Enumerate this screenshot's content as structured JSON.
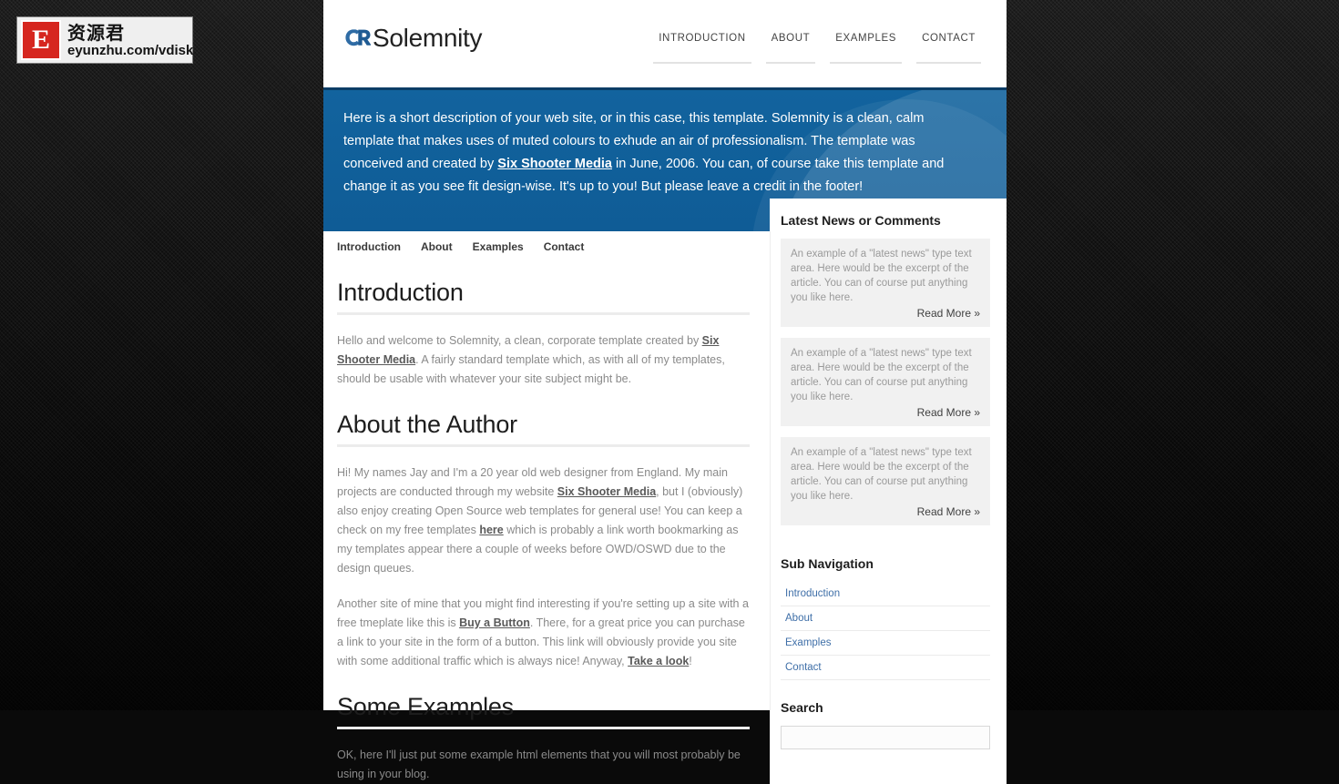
{
  "watermark": {
    "logo_letter": "E",
    "chinese_text": "资源君",
    "url_text": "eyunzhu.com/vdisk"
  },
  "header": {
    "logo_text": "Solemnity",
    "logo_icon": "interlocking-circles-logo-icon",
    "nav": [
      {
        "label": "INTRODUCTION"
      },
      {
        "label": "ABOUT"
      },
      {
        "label": "EXAMPLES"
      },
      {
        "label": "CONTACT"
      }
    ]
  },
  "banner": {
    "text_part1": "Here is a short description of your web site, or in this case, this template. Solemnity is a clean, calm template that makes uses of muted colours to exhude an air of professionalism. The template was conceived and created by ",
    "link_label": "Six Shooter Media",
    "text_part2": " in June, 2006. You can, of course take this template and change it as you see fit design-wise. It's up to you! But please leave a credit in the footer!"
  },
  "content": {
    "subnav": [
      {
        "label": "Introduction"
      },
      {
        "label": "About"
      },
      {
        "label": "Examples"
      },
      {
        "label": "Contact"
      }
    ],
    "sections": [
      {
        "title": "Introduction",
        "p1_a": "Hello and welcome to Solemnity, a clean, corporate template created by ",
        "p1_link": "Six Shooter Media",
        "p1_b": ". A fairly standard template which, as with all of my templates, should be usable with whatever your site subject might be."
      },
      {
        "title": "About the Author",
        "p1_a": "Hi! My names Jay and I'm a 20 year old web designer from England. My main projects are conducted through my website ",
        "p1_link": "Six Shooter Media",
        "p1_b": ", but I (obviously) also enjoy creating Open Source web templates for general use! You can keep a check on my free templates ",
        "p1_link2": "here",
        "p1_c": " which is probably a link worth bookmarking as my templates appear there a couple of weeks before OWD/OSWD due to the design queues.",
        "p2_a": "Another site of mine that you might find interesting if you're setting up a site with a free tmeplate like this is ",
        "p2_link": "Buy a Button",
        "p2_b": ". There, for a great price you can purchase a link to your site in the form of a button. This link will obviously provide you site with some additional traffic which is always nice! Anyway, ",
        "p2_link2": "Take a look",
        "p2_c": "!"
      },
      {
        "title": "Some Examples",
        "p1": "OK, here I'll just put some example html elements that you will most probably be using in your blog."
      }
    ]
  },
  "sidebar": {
    "news_title": "Latest News or Comments",
    "news_items": [
      {
        "text": "An example of a \"latest news\" type text area. Here would be the excerpt of the article. You can of course put anything you like here.",
        "more_label": "Read More »"
      },
      {
        "text": "An example of a \"latest news\" type text area. Here would be the excerpt of the article. You can of course put anything you like here.",
        "more_label": "Read More »"
      },
      {
        "text": "An example of a \"latest news\" type text area. Here would be the excerpt of the article. You can of course put anything you like here.",
        "more_label": "Read More »"
      }
    ],
    "subnav_title": "Sub Navigation",
    "subnav_items": [
      {
        "label": "Introduction"
      },
      {
        "label": "About"
      },
      {
        "label": "Examples"
      },
      {
        "label": "Contact"
      }
    ],
    "search_title": "Search",
    "search_value": "",
    "search_placeholder": ""
  },
  "colors": {
    "banner_blue": "#0f5e99",
    "banner_border": "#0b3d66",
    "link_blue": "#3f6fa8",
    "body_text": "#8a8a8a",
    "watermark_red": "#d6261f",
    "page_bg": "#ffffff",
    "site_bg": "#111111"
  }
}
